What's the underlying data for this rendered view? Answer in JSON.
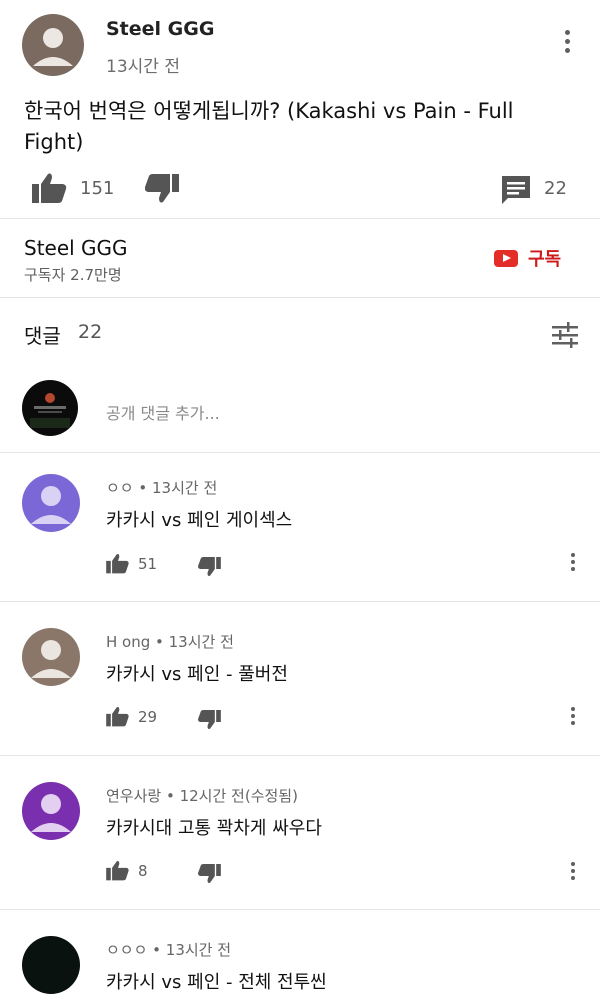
{
  "post": {
    "author": "Steel GGG",
    "time": "13시간 전",
    "text": "한국어 번역은 어떻게됩니까? (Kakashi vs Pain - Full Fight)",
    "likes": "151",
    "replies": "22"
  },
  "channel": {
    "name": "Steel GGG",
    "subscribers": "구독자 2.7만명",
    "subscribe_label": "구독"
  },
  "comments_header": {
    "title": "댓글",
    "count": "22"
  },
  "add_comment": {
    "placeholder": "공개 댓글 추가..."
  },
  "comments": [
    {
      "meta": "ㅇㅇ • 13시간 전",
      "text": "카카시 vs 페인 게이섹스",
      "likes": "51"
    },
    {
      "meta": "H ong • 13시간 전",
      "text": "카카시 vs 페인 - 풀버전",
      "likes": "29"
    },
    {
      "meta": "연우사랑 • 12시간 전(수정됨)",
      "text": "카카시대 고통 꽉차게 싸우다",
      "likes": "8"
    },
    {
      "meta": "ㅇㅇㅇ • 13시간 전",
      "text": "카카시 vs 페인 - 전체 전투씬"
    }
  ],
  "colors": {
    "subscribe_red": "#e52d27",
    "avatar_brown": "#7a6a5f",
    "avatar_purple_light": "#7b68d6",
    "avatar_purple_dark": "#7a2fae"
  },
  "icons": [
    "kebab-icon",
    "thumb-up-icon",
    "thumb-down-icon",
    "comment-icon",
    "youtube-icon",
    "sort-icon"
  ]
}
